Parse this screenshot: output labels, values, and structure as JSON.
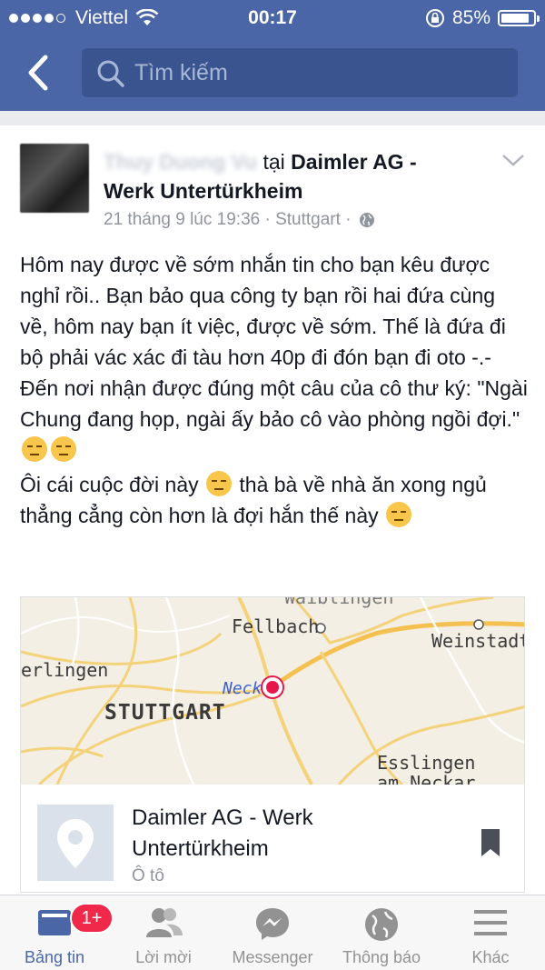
{
  "status_bar": {
    "carrier": "Viettel",
    "time": "00:17",
    "battery": "85%"
  },
  "search": {
    "placeholder": "Tìm kiếm"
  },
  "post": {
    "author_name": "Thuy Duong Vu",
    "at": "tại",
    "location_line1": "Daimler AG -",
    "location_line2": "Werk Untertürkheim",
    "date": "21 tháng 9 lúc 19:36",
    "separator": "·",
    "city": "Stuttgart",
    "para1": "Hôm nay được về sớm nhắn tin cho bạn kêu được nghỉ rồi.. Bạn bảo qua công ty bạn rồi hai đứa cùng về, hôm nay bạn ít việc, được về sớm. Thế là đứa đi bộ phải vác xác đi tàu hơn 40p đi đón bạn đi oto -.-",
    "para2": "Đến nơi nhận được đúng một câu của cô thư ký: \"Ngài Chung đang họp, ngài ấy bảo cô vào phòng ngồi đợi.\"",
    "para3a": "Ôi cái cuộc đời này",
    "para3b": "thà bà về nhà ăn xong ngủ thẳng cẳng còn hơn là đợi hắn thế này"
  },
  "map": {
    "labels": {
      "top": "Waiblingen",
      "fellbach": "Fellbach",
      "weinstadt": "Weinstadt",
      "erlingen": "erlingen",
      "neckar": "Neck",
      "stuttgart": "STUTTGART",
      "esslingen1": "Esslingen",
      "esslingen2": "am Neckar"
    }
  },
  "place": {
    "name": "Daimler AG - Werk Untertürkheim",
    "category": "Ô tô"
  },
  "tabbar": {
    "tabs": [
      {
        "label": "Bảng tin",
        "badge": "1+"
      },
      {
        "label": "Lời mời"
      },
      {
        "label": "Messenger"
      },
      {
        "label": "Thông báo"
      },
      {
        "label": "Khác"
      }
    ]
  },
  "colors": {
    "header": "#4b66a6",
    "badge": "#f02849",
    "pin": "#e8174b"
  }
}
